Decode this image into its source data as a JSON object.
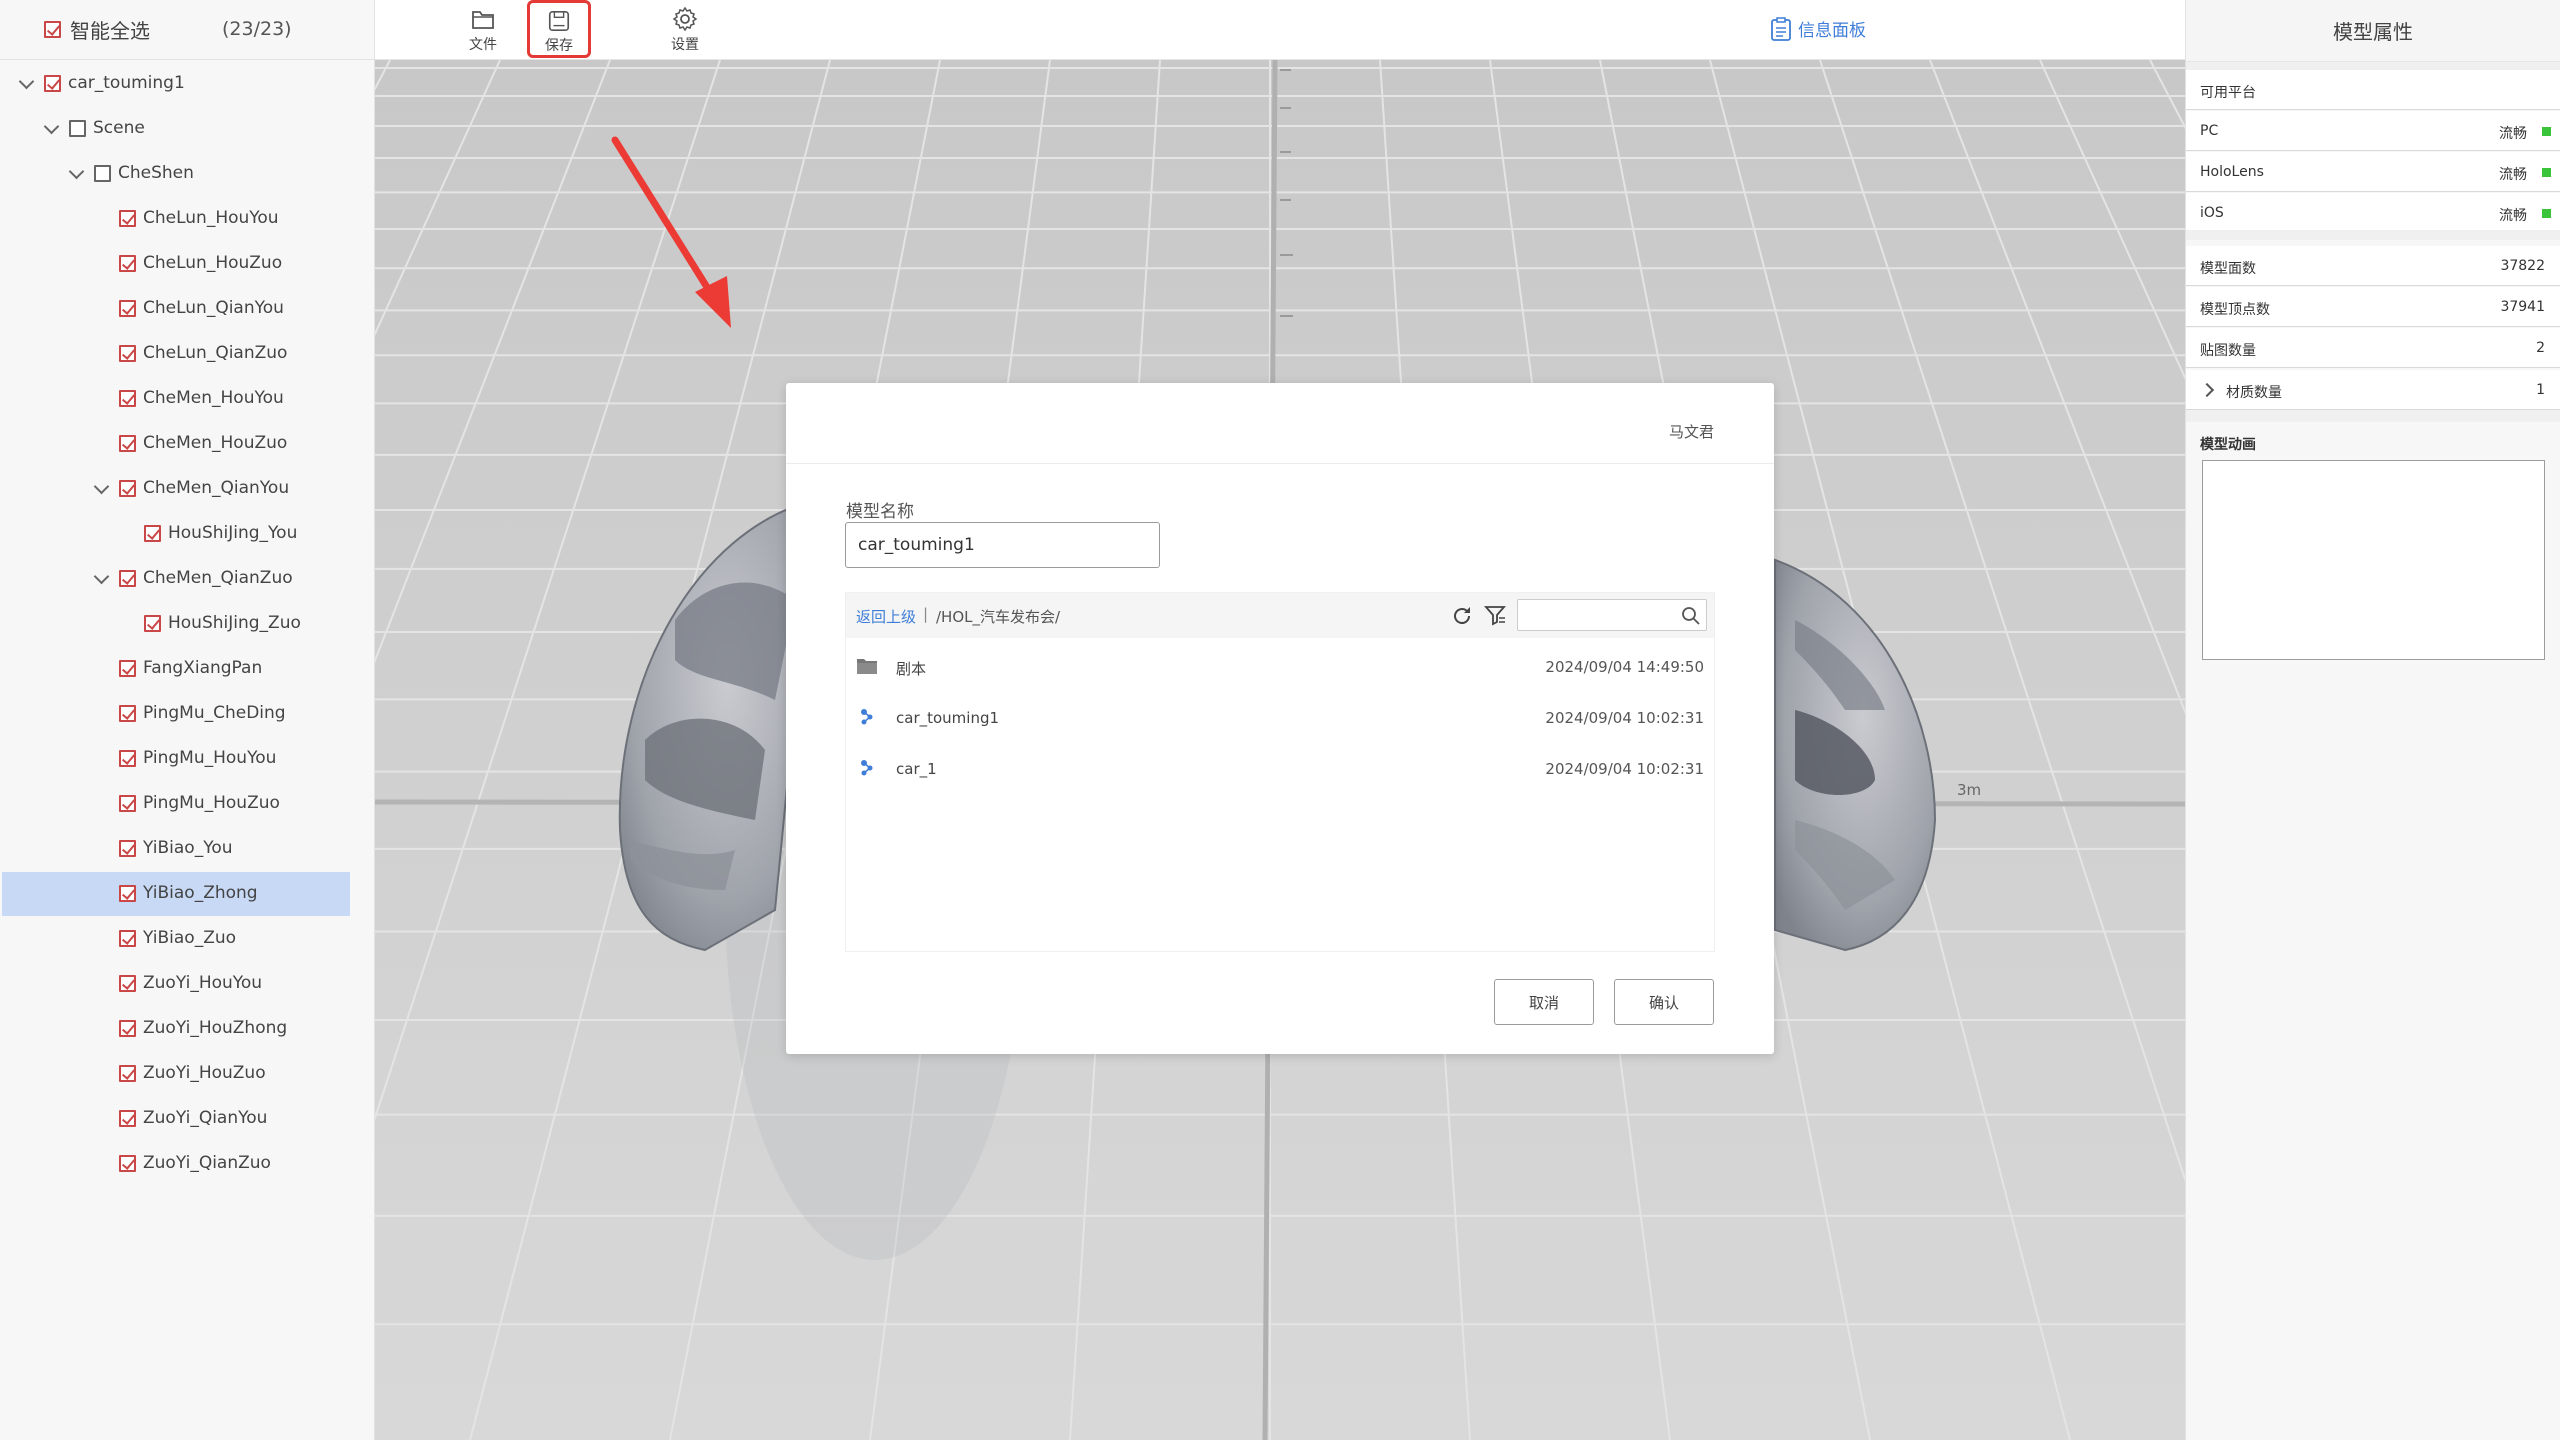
{
  "tree": {
    "select_all_label": "智能全选",
    "select_count": "(23/23)",
    "items": [
      {
        "label": "car_touming1",
        "level": 0,
        "expanded": true,
        "checked": true
      },
      {
        "label": "Scene",
        "level": 1,
        "expanded": true,
        "checked": false
      },
      {
        "label": "CheShen",
        "level": 2,
        "expanded": true,
        "checked": false
      },
      {
        "label": "CheLun_HouYou",
        "level": 3,
        "checked": true
      },
      {
        "label": "CheLun_HouZuo",
        "level": 3,
        "checked": true
      },
      {
        "label": "CheLun_QianYou",
        "level": 3,
        "checked": true
      },
      {
        "label": "CheLun_QianZuo",
        "level": 3,
        "checked": true
      },
      {
        "label": "CheMen_HouYou",
        "level": 3,
        "checked": true
      },
      {
        "label": "CheMen_HouZuo",
        "level": 3,
        "checked": true
      },
      {
        "label": "CheMen_QianYou",
        "level": 3,
        "expanded": true,
        "checked": true
      },
      {
        "label": "HouShiJing_You",
        "level": 4,
        "checked": true
      },
      {
        "label": "CheMen_QianZuo",
        "level": 3,
        "expanded": true,
        "checked": true
      },
      {
        "label": "HouShiJing_Zuo",
        "level": 4,
        "checked": true
      },
      {
        "label": "FangXiangPan",
        "level": 3,
        "checked": true
      },
      {
        "label": "PingMu_CheDing",
        "level": 3,
        "checked": true
      },
      {
        "label": "PingMu_HouYou",
        "level": 3,
        "checked": true
      },
      {
        "label": "PingMu_HouZuo",
        "level": 3,
        "checked": true
      },
      {
        "label": "YiBiao_You",
        "level": 3,
        "checked": true
      },
      {
        "label": "YiBiao_Zhong",
        "level": 3,
        "checked": true,
        "selected": true
      },
      {
        "label": "YiBiao_Zuo",
        "level": 3,
        "checked": true
      },
      {
        "label": "ZuoYi_HouYou",
        "level": 3,
        "checked": true
      },
      {
        "label": "ZuoYi_HouZhong",
        "level": 3,
        "checked": true
      },
      {
        "label": "ZuoYi_HouZuo",
        "level": 3,
        "checked": true
      },
      {
        "label": "ZuoYi_QianYou",
        "level": 3,
        "checked": true
      },
      {
        "label": "ZuoYi_QianZuo",
        "level": 3,
        "checked": true
      }
    ]
  },
  "toolbar": {
    "file_label": "文件",
    "save_label": "保存",
    "settings_label": "设置",
    "info_panel_label": "信息面板"
  },
  "viewport": {
    "distance_label": "3m"
  },
  "properties": {
    "title": "模型属性",
    "platforms_header": "可用平台",
    "platforms": [
      {
        "name": "PC",
        "status": "流畅"
      },
      {
        "name": "HoloLens",
        "status": "流畅"
      },
      {
        "name": "iOS",
        "status": "流畅"
      }
    ],
    "stats": [
      {
        "key": "模型面数",
        "value": "37822"
      },
      {
        "key": "模型顶点数",
        "value": "37941"
      },
      {
        "key": "贴图数量",
        "value": "2"
      }
    ],
    "material_label": "材质数量",
    "material_value": "1",
    "animation_title": "模型动画"
  },
  "dialog": {
    "user": "马文君",
    "model_name_label": "模型名称",
    "model_name_value": "car_touming1",
    "back_link": "返回上级",
    "path_sep": "|",
    "path": "/HOL_汽车发布会/",
    "files": [
      {
        "name": "剧本",
        "type": "folder",
        "date": "2024/09/04 14:49:50"
      },
      {
        "name": "car_touming1",
        "type": "model",
        "date": "2024/09/04 10:02:31"
      },
      {
        "name": "car_1",
        "type": "model",
        "date": "2024/09/04 10:02:31"
      }
    ],
    "cancel_label": "取消",
    "confirm_label": "确认"
  },
  "colors": {
    "accent_blue": "#3f7ed8",
    "highlight_red": "#e53935",
    "status_green": "#3ac43a",
    "selection_bg": "#c7d9f5"
  }
}
